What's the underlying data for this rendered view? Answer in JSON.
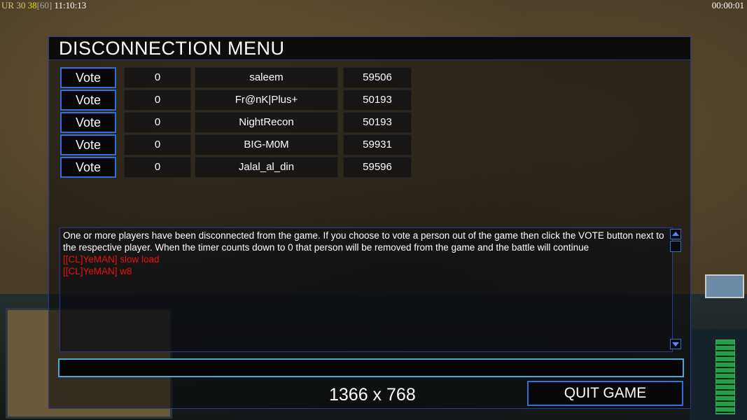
{
  "hud": {
    "ur": "UR",
    "val1": "30",
    "val2": "38",
    "val3": "[60]",
    "clock": "11:10:13",
    "timer": "00:00:01"
  },
  "dialog": {
    "title": "DISCONNECTION MENU",
    "vote_label": "Vote",
    "players": [
      {
        "votes": "0",
        "name": "saleem",
        "ping": "59506"
      },
      {
        "votes": "0",
        "name": "Fr@nK|Plus+",
        "ping": "50193"
      },
      {
        "votes": "0",
        "name": "NightRecon",
        "ping": "50193"
      },
      {
        "votes": "0",
        "name": "BIG-M0M",
        "ping": "59931"
      },
      {
        "votes": "0",
        "name": "Jalal_al_din",
        "ping": "59596"
      }
    ],
    "chat": {
      "message": "One or more players have been disconnected from the game. If you choose to vote a person out of the game then click the VOTE button next to the respective player. When the timer counts down to 0 that person will be removed from the game and the battle will continue",
      "lines": [
        "[[CL]YeMAN] slow load",
        "[[CL]YeMAN] w8"
      ]
    },
    "resolution": "1366 x 768",
    "quit_label": "QUIT GAME"
  },
  "colors": {
    "accent_border": "#2e6fd8",
    "chat_red": "#e81010"
  }
}
